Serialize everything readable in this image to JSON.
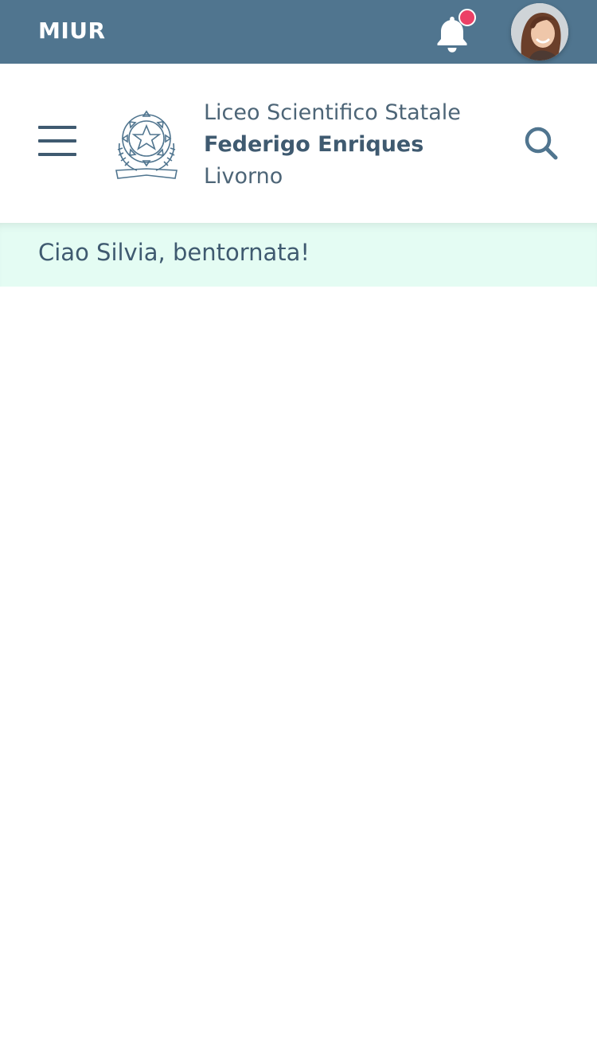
{
  "topbar": {
    "brand": "MIUR",
    "notification_icon": "bell-icon",
    "has_unread_notifications": true,
    "badge_color": "#ec4066",
    "background_color": "#50758f"
  },
  "header": {
    "menu_icon": "hamburger-icon",
    "emblem_icon": "italian-republic-emblem",
    "school_type": "Liceo Scientifico Statale",
    "school_name": "Federigo Enriques",
    "school_city": "Livorno",
    "search_icon": "search-icon"
  },
  "greeting": {
    "text": "Ciao Silvia, bentornata!",
    "background_color": "#e4fcf3"
  }
}
